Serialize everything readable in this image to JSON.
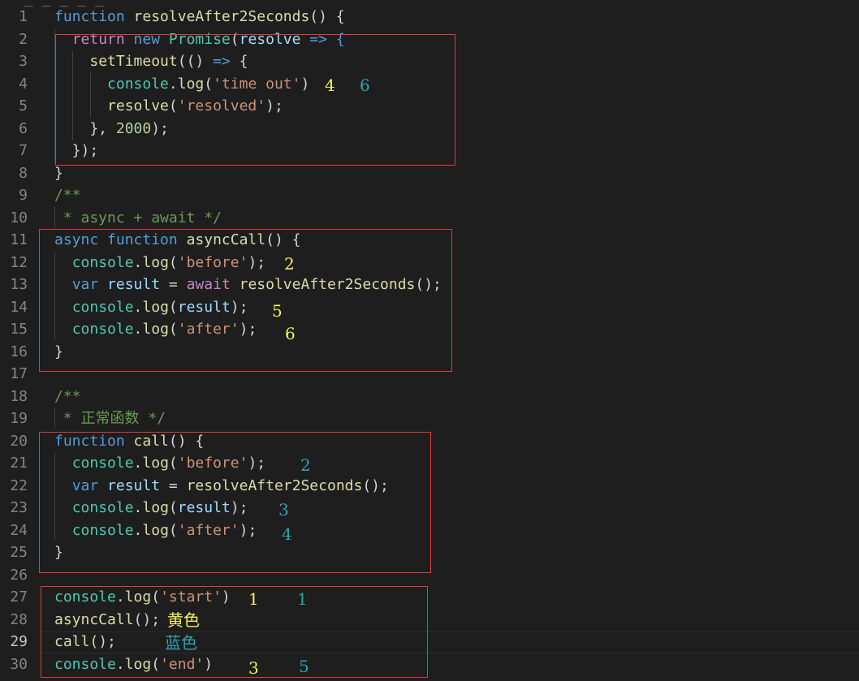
{
  "editor": {
    "top_cut_text": "_ _ _ _ _",
    "active_line": 29,
    "lines": [
      {
        "n": "1",
        "tokens": [
          {
            "t": "function ",
            "c": "kw"
          },
          {
            "t": "resolveAfter2Seconds",
            "c": "fn"
          },
          {
            "t": "() {",
            "c": "p"
          }
        ]
      },
      {
        "n": "2",
        "tokens": [
          {
            "t": "  ",
            "c": "p"
          },
          {
            "t": "return ",
            "c": "ctl"
          },
          {
            "t": "new ",
            "c": "kw"
          },
          {
            "t": "Promise",
            "c": "cls"
          },
          {
            "t": "(",
            "c": "p"
          },
          {
            "t": "resolve",
            "c": "var"
          },
          {
            "t": " => {",
            "c": "kw"
          }
        ]
      },
      {
        "n": "3",
        "tokens": [
          {
            "t": "    ",
            "c": "p"
          },
          {
            "t": "setTimeout",
            "c": "fn"
          },
          {
            "t": "(() ",
            "c": "p"
          },
          {
            "t": "=>",
            "c": "kw"
          },
          {
            "t": " {",
            "c": "p"
          }
        ]
      },
      {
        "n": "4",
        "tokens": [
          {
            "t": "      ",
            "c": "p"
          },
          {
            "t": "console",
            "c": "cls"
          },
          {
            "t": ".",
            "c": "p"
          },
          {
            "t": "log",
            "c": "fn"
          },
          {
            "t": "(",
            "c": "p"
          },
          {
            "t": "'time out'",
            "c": "str"
          },
          {
            "t": ")",
            "c": "p"
          }
        ]
      },
      {
        "n": "5",
        "tokens": [
          {
            "t": "      ",
            "c": "p"
          },
          {
            "t": "resolve",
            "c": "fn"
          },
          {
            "t": "(",
            "c": "p"
          },
          {
            "t": "'resolved'",
            "c": "str"
          },
          {
            "t": ");",
            "c": "p"
          }
        ]
      },
      {
        "n": "6",
        "tokens": [
          {
            "t": "    }, ",
            "c": "p"
          },
          {
            "t": "2000",
            "c": "num"
          },
          {
            "t": ");",
            "c": "p"
          }
        ]
      },
      {
        "n": "7",
        "tokens": [
          {
            "t": "  });",
            "c": "p"
          }
        ]
      },
      {
        "n": "8",
        "tokens": [
          {
            "t": "}",
            "c": "p"
          }
        ]
      },
      {
        "n": "9",
        "tokens": [
          {
            "t": "/**",
            "c": "cmt"
          }
        ]
      },
      {
        "n": "10",
        "tokens": [
          {
            "t": " * async + await */",
            "c": "cmt"
          }
        ]
      },
      {
        "n": "11",
        "tokens": [
          {
            "t": "async ",
            "c": "kw"
          },
          {
            "t": "function ",
            "c": "kw"
          },
          {
            "t": "asyncCall",
            "c": "fn"
          },
          {
            "t": "() {",
            "c": "p"
          }
        ]
      },
      {
        "n": "12",
        "tokens": [
          {
            "t": "  ",
            "c": "p"
          },
          {
            "t": "console",
            "c": "cls"
          },
          {
            "t": ".",
            "c": "p"
          },
          {
            "t": "log",
            "c": "fn"
          },
          {
            "t": "(",
            "c": "p"
          },
          {
            "t": "'before'",
            "c": "str"
          },
          {
            "t": ");",
            "c": "p"
          }
        ]
      },
      {
        "n": "13",
        "tokens": [
          {
            "t": "  ",
            "c": "p"
          },
          {
            "t": "var ",
            "c": "kw"
          },
          {
            "t": "result",
            "c": "var"
          },
          {
            "t": " = ",
            "c": "p"
          },
          {
            "t": "await ",
            "c": "ctl"
          },
          {
            "t": "resolveAfter2Seconds",
            "c": "fn"
          },
          {
            "t": "();",
            "c": "p"
          }
        ]
      },
      {
        "n": "14",
        "tokens": [
          {
            "t": "  ",
            "c": "p"
          },
          {
            "t": "console",
            "c": "cls"
          },
          {
            "t": ".",
            "c": "p"
          },
          {
            "t": "log",
            "c": "fn"
          },
          {
            "t": "(",
            "c": "p"
          },
          {
            "t": "result",
            "c": "var"
          },
          {
            "t": ");",
            "c": "p"
          }
        ]
      },
      {
        "n": "15",
        "tokens": [
          {
            "t": "  ",
            "c": "p"
          },
          {
            "t": "console",
            "c": "cls"
          },
          {
            "t": ".",
            "c": "p"
          },
          {
            "t": "log",
            "c": "fn"
          },
          {
            "t": "(",
            "c": "p"
          },
          {
            "t": "'after'",
            "c": "str"
          },
          {
            "t": ");",
            "c": "p"
          }
        ]
      },
      {
        "n": "16",
        "tokens": [
          {
            "t": "}",
            "c": "p"
          }
        ]
      },
      {
        "n": "17",
        "tokens": []
      },
      {
        "n": "18",
        "tokens": [
          {
            "t": "/**",
            "c": "cmt"
          }
        ]
      },
      {
        "n": "19",
        "tokens": [
          {
            "t": " * 正常函数 */",
            "c": "cmt"
          }
        ]
      },
      {
        "n": "20",
        "tokens": [
          {
            "t": "function ",
            "c": "kw"
          },
          {
            "t": "call",
            "c": "fn"
          },
          {
            "t": "() {",
            "c": "p"
          }
        ]
      },
      {
        "n": "21",
        "tokens": [
          {
            "t": "  ",
            "c": "p"
          },
          {
            "t": "console",
            "c": "cls"
          },
          {
            "t": ".",
            "c": "p"
          },
          {
            "t": "log",
            "c": "fn"
          },
          {
            "t": "(",
            "c": "p"
          },
          {
            "t": "'before'",
            "c": "str"
          },
          {
            "t": ");",
            "c": "p"
          }
        ]
      },
      {
        "n": "22",
        "tokens": [
          {
            "t": "  ",
            "c": "p"
          },
          {
            "t": "var ",
            "c": "kw"
          },
          {
            "t": "result",
            "c": "var"
          },
          {
            "t": " = ",
            "c": "p"
          },
          {
            "t": "resolveAfter2Seconds",
            "c": "fn"
          },
          {
            "t": "();",
            "c": "p"
          }
        ]
      },
      {
        "n": "23",
        "tokens": [
          {
            "t": "  ",
            "c": "p"
          },
          {
            "t": "console",
            "c": "cls"
          },
          {
            "t": ".",
            "c": "p"
          },
          {
            "t": "log",
            "c": "fn"
          },
          {
            "t": "(",
            "c": "p"
          },
          {
            "t": "result",
            "c": "var"
          },
          {
            "t": ");",
            "c": "p"
          }
        ]
      },
      {
        "n": "24",
        "tokens": [
          {
            "t": "  ",
            "c": "p"
          },
          {
            "t": "console",
            "c": "cls"
          },
          {
            "t": ".",
            "c": "p"
          },
          {
            "t": "log",
            "c": "fn"
          },
          {
            "t": "(",
            "c": "p"
          },
          {
            "t": "'after'",
            "c": "str"
          },
          {
            "t": ");",
            "c": "p"
          }
        ]
      },
      {
        "n": "25",
        "tokens": [
          {
            "t": "}",
            "c": "p"
          }
        ]
      },
      {
        "n": "26",
        "tokens": []
      },
      {
        "n": "27",
        "tokens": [
          {
            "t": "console",
            "c": "cls"
          },
          {
            "t": ".",
            "c": "p"
          },
          {
            "t": "log",
            "c": "fn"
          },
          {
            "t": "(",
            "c": "p"
          },
          {
            "t": "'start'",
            "c": "str"
          },
          {
            "t": ")",
            "c": "p"
          }
        ]
      },
      {
        "n": "28",
        "tokens": [
          {
            "t": "asyncCall",
            "c": "fn"
          },
          {
            "t": "();",
            "c": "p"
          }
        ]
      },
      {
        "n": "29",
        "tokens": [
          {
            "t": "call",
            "c": "fn"
          },
          {
            "t": "();",
            "c": "p"
          }
        ]
      },
      {
        "n": "30",
        "tokens": [
          {
            "t": "console",
            "c": "cls"
          },
          {
            "t": ".",
            "c": "p"
          },
          {
            "t": "log",
            "c": "fn"
          },
          {
            "t": "(",
            "c": "p"
          },
          {
            "t": "'end'",
            "c": "str"
          },
          {
            "t": ")",
            "c": "p"
          }
        ]
      }
    ]
  },
  "annotations": {
    "timeout_yellow": "4",
    "timeout_teal": "6",
    "async_before": "2",
    "async_result": "5",
    "async_after": "6",
    "call_before": "2",
    "call_result": "3",
    "call_after": "4",
    "start_yellow": "1",
    "start_teal": "1",
    "label_yellow": "黄色",
    "label_blue": "蓝色",
    "end_yellow": "3",
    "end_teal": "5"
  },
  "colors": {
    "background": "#1e1e1e",
    "box_border": "#e5393a",
    "annotation_yellow": "#f2f25a",
    "annotation_teal": "#2ea3b0"
  }
}
